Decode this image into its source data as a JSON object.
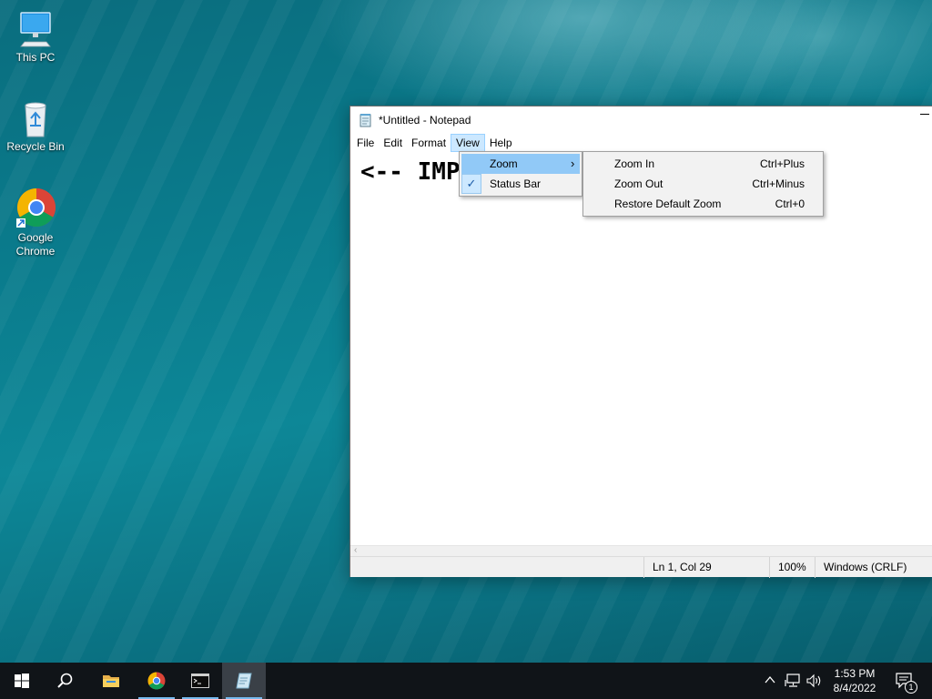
{
  "desktop": {
    "icons": [
      {
        "label": "This PC"
      },
      {
        "label": "Recycle Bin"
      },
      {
        "label": "Google Chrome"
      }
    ]
  },
  "notepad": {
    "title": "*Untitled - Notepad",
    "menu": [
      "File",
      "Edit",
      "Format",
      "View",
      "Help"
    ],
    "active_menu": "View",
    "editor_text": "<-- IMPORTANT",
    "status": {
      "position": "Ln 1, Col 29",
      "zoom": "100%",
      "line_ending": "Windows (CRLF)"
    }
  },
  "view_menu": {
    "items": [
      {
        "label": "Zoom",
        "has_submenu": true,
        "highlighted": true
      },
      {
        "label": "Status Bar",
        "checked": true
      }
    ]
  },
  "zoom_submenu": {
    "items": [
      {
        "label": "Zoom In",
        "shortcut": "Ctrl+Plus"
      },
      {
        "label": "Zoom Out",
        "shortcut": "Ctrl+Minus"
      },
      {
        "label": "Restore Default Zoom",
        "shortcut": "Ctrl+0"
      }
    ]
  },
  "taskbar": {
    "apps": [
      "start-icon",
      "search-icon",
      "file-explorer-icon",
      "chrome-icon",
      "terminal-icon",
      "notepad-icon"
    ],
    "clock_time": "1:53 PM",
    "clock_date": "8/4/2022",
    "notification_count": "1",
    "accent": "#76b9ed"
  }
}
